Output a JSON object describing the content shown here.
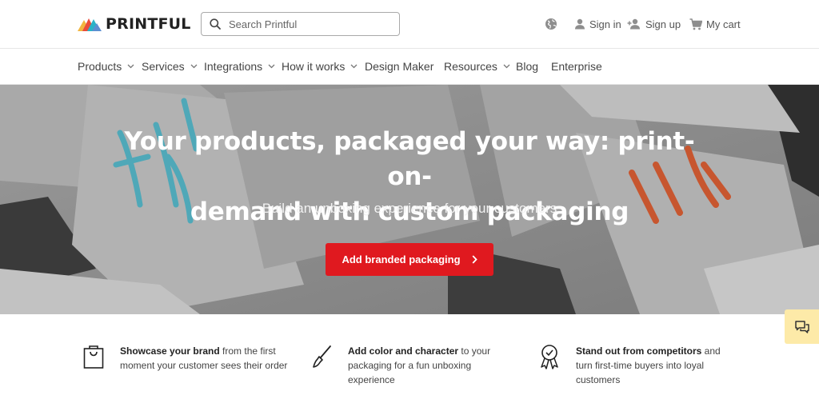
{
  "header": {
    "logo_text": "PRINTFUL",
    "search": {
      "placeholder": "Search Printful"
    },
    "signin_label": "Sign in",
    "signup_label": "Sign up",
    "cart_label": "My cart"
  },
  "nav": {
    "items": [
      {
        "label": "Products",
        "has_dropdown": true
      },
      {
        "label": "Services",
        "has_dropdown": true
      },
      {
        "label": "Integrations",
        "has_dropdown": true
      },
      {
        "label": "How it works",
        "has_dropdown": true
      },
      {
        "label": "Design Maker",
        "has_dropdown": false
      },
      {
        "label": "Resources",
        "has_dropdown": true
      },
      {
        "label": "Blog",
        "has_dropdown": false
      },
      {
        "label": "Enterprise",
        "has_dropdown": false
      }
    ]
  },
  "hero": {
    "title_line1": "Your products, packaged your way: print-on-",
    "title_line2": "demand with custom packaging",
    "subtitle": "Build an unboxing experience for your customers",
    "cta_label": "Add branded packaging"
  },
  "features": [
    {
      "bold": "Showcase your brand",
      "rest": " from the first moment your customer sees their order",
      "icon": "shopping-bag-icon"
    },
    {
      "bold": "Add color and character",
      "rest": " to your packaging for a fun unboxing experience",
      "icon": "paintbrush-icon"
    },
    {
      "bold": "Stand out from competitors",
      "rest": " and turn first-time buyers into loyal customers",
      "icon": "award-ribbon-icon"
    }
  ],
  "colors": {
    "accent": "#e0191f",
    "chat_bg": "#fdeaa8",
    "hero_overlay": "#8a8a8a"
  }
}
